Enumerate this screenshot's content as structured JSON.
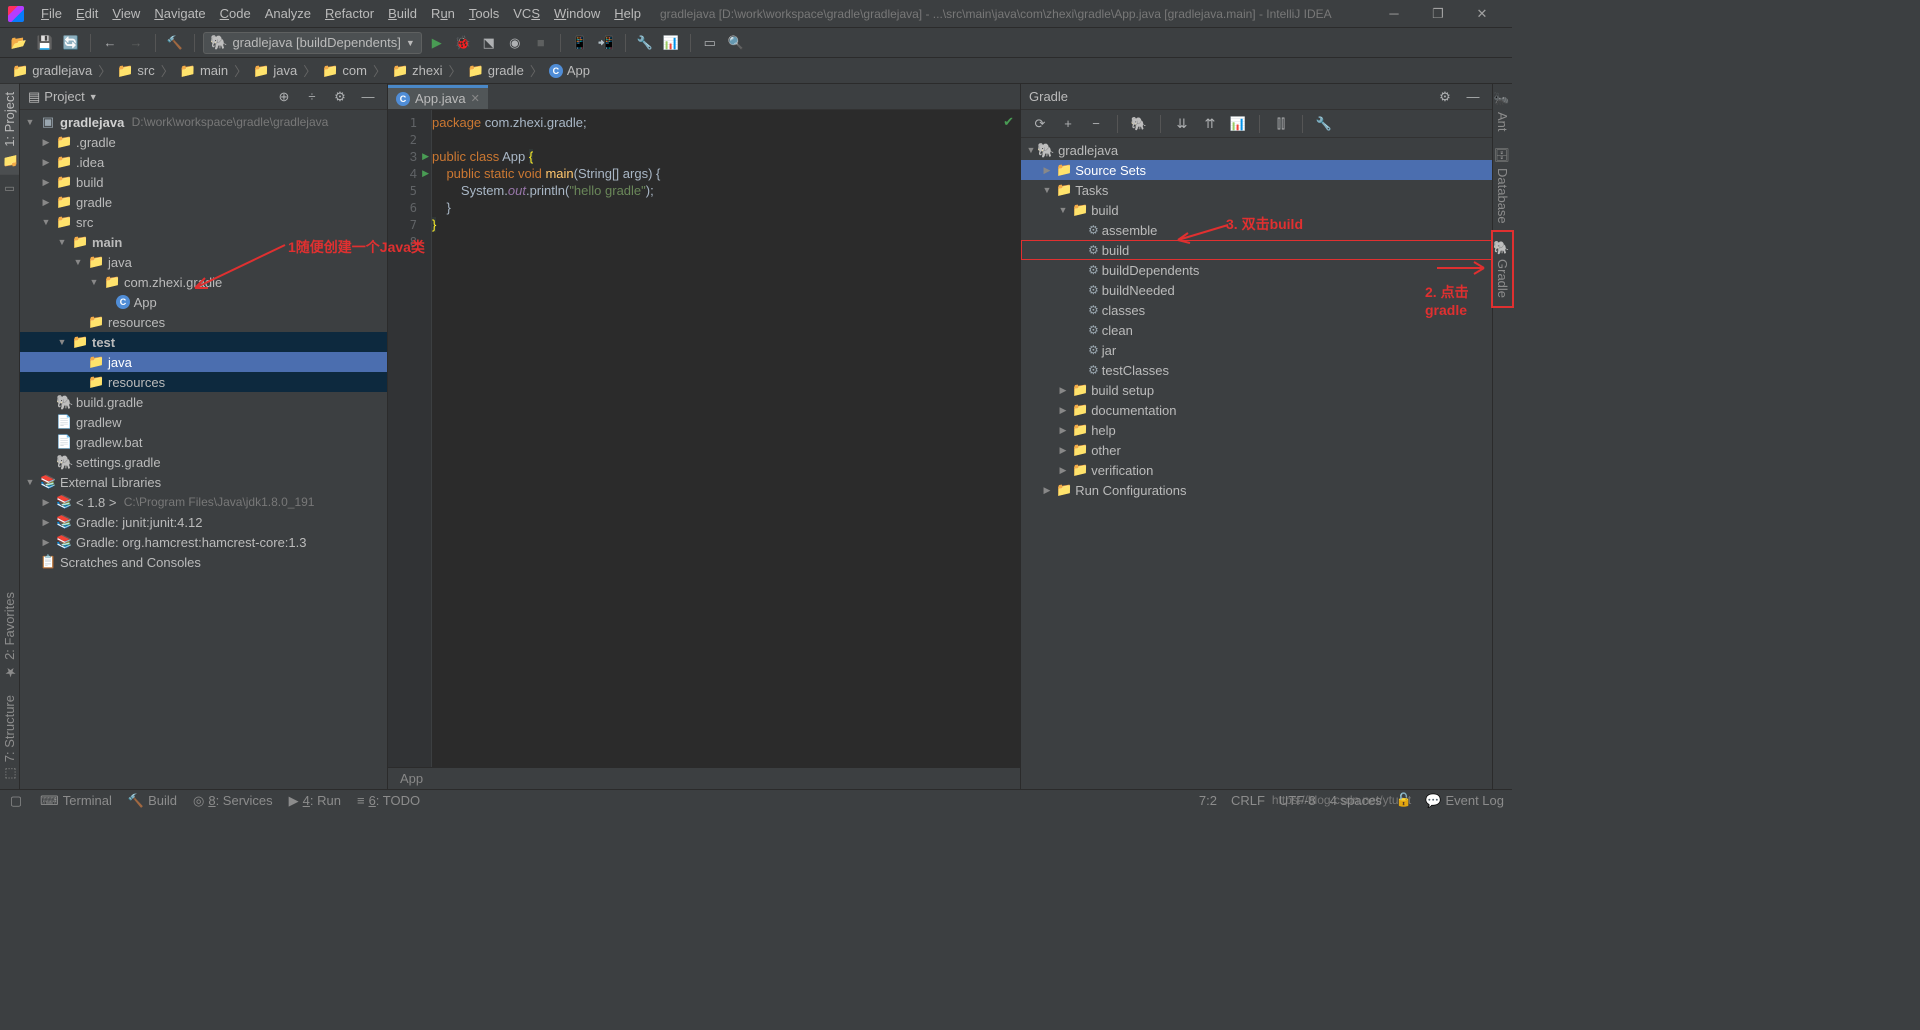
{
  "menu": [
    "File",
    "Edit",
    "View",
    "Navigate",
    "Code",
    "Analyze",
    "Refactor",
    "Build",
    "Run",
    "Tools",
    "VCS",
    "Window",
    "Help"
  ],
  "title_path": "gradlejava [D:\\work\\workspace\\gradle\\gradlejava] - ...\\src\\main\\java\\com\\zhexi\\gradle\\App.java [gradlejava.main] - IntelliJ IDEA",
  "run_config": "gradlejava [buildDependents]",
  "breadcrumbs": [
    "gradlejava",
    "src",
    "main",
    "java",
    "com",
    "zhexi",
    "gradle",
    "App"
  ],
  "panel": {
    "title": "Project"
  },
  "proj_root": {
    "name": "gradlejava",
    "path": "D:\\work\\workspace\\gradle\\gradlejava"
  },
  "tree": {
    "gradle_dir": ".gradle",
    "idea_dir": ".idea",
    "build": "build",
    "gradle": "gradle",
    "src": "src",
    "main": "main",
    "java": "java",
    "pkg": "com.zhexi.gradle",
    "app": "App",
    "resources": "resources",
    "test": "test",
    "test_java": "java",
    "test_res": "resources",
    "build_gradle": "build.gradle",
    "gradlew": "gradlew",
    "gradlewbat": "gradlew.bat",
    "settings": "settings.gradle",
    "ext": "External Libraries",
    "jdk": "< 1.8 >",
    "jdk_path": "C:\\Program Files\\Java\\jdk1.8.0_191",
    "junit": "Gradle: junit:junit:4.12",
    "hamcrest": "Gradle: org.hamcrest:hamcrest-core:1.3",
    "scratch": "Scratches and Consoles"
  },
  "editor": {
    "tab": "App.java",
    "lines": [
      "1",
      "2",
      "3",
      "4",
      "5",
      "6",
      "7",
      "8"
    ],
    "code_package": "package ",
    "code_pkg": "com.zhexi.gradle",
    "code_sc": ";",
    "code_pub": "public ",
    "code_class": "class ",
    "code_App": "App ",
    "code_lb": "{",
    "code_static": "static ",
    "code_void": "void ",
    "code_main": "main",
    "code_args": "(String[] args) ",
    "code_sys": "System.",
    "code_out": "out",
    "code_pl": ".println(",
    "code_str": "\"hello gradle\"",
    "code_end": ");",
    "code_rb": "}",
    "breadcrumb": "App"
  },
  "gradle": {
    "title": "Gradle",
    "root": "gradlejava",
    "source_sets": "Source Sets",
    "tasks": "Tasks",
    "build_folder": "build",
    "tasks_build": [
      "assemble",
      "build",
      "buildDependents",
      "buildNeeded",
      "classes",
      "clean",
      "jar",
      "testClasses"
    ],
    "build_setup": "build setup",
    "documentation": "documentation",
    "help": "help",
    "other": "other",
    "verification": "verification",
    "run_configs": "Run Configurations"
  },
  "annot": {
    "a1": "1随便创建一个Java类",
    "a2": "2. 点击gradle",
    "a3": "3. 双击build"
  },
  "status": {
    "terminal": "Terminal",
    "build": "Build",
    "services": "8: Services",
    "run": "4: Run",
    "todo": "6: TODO",
    "eventlog": "Event Log",
    "pos": "7:2",
    "crlf": "CRLF",
    "enc": "UTF-8",
    "indent": "4 spaces",
    "watermark": "https://blog.csdn.net/ytualt"
  },
  "left_tabs": {
    "project": "1: Project",
    "favorites": "2: Favorites",
    "structure": "7: Structure"
  },
  "right_tabs": {
    "ant": "Ant",
    "database": "Database",
    "gradle": "Gradle"
  }
}
